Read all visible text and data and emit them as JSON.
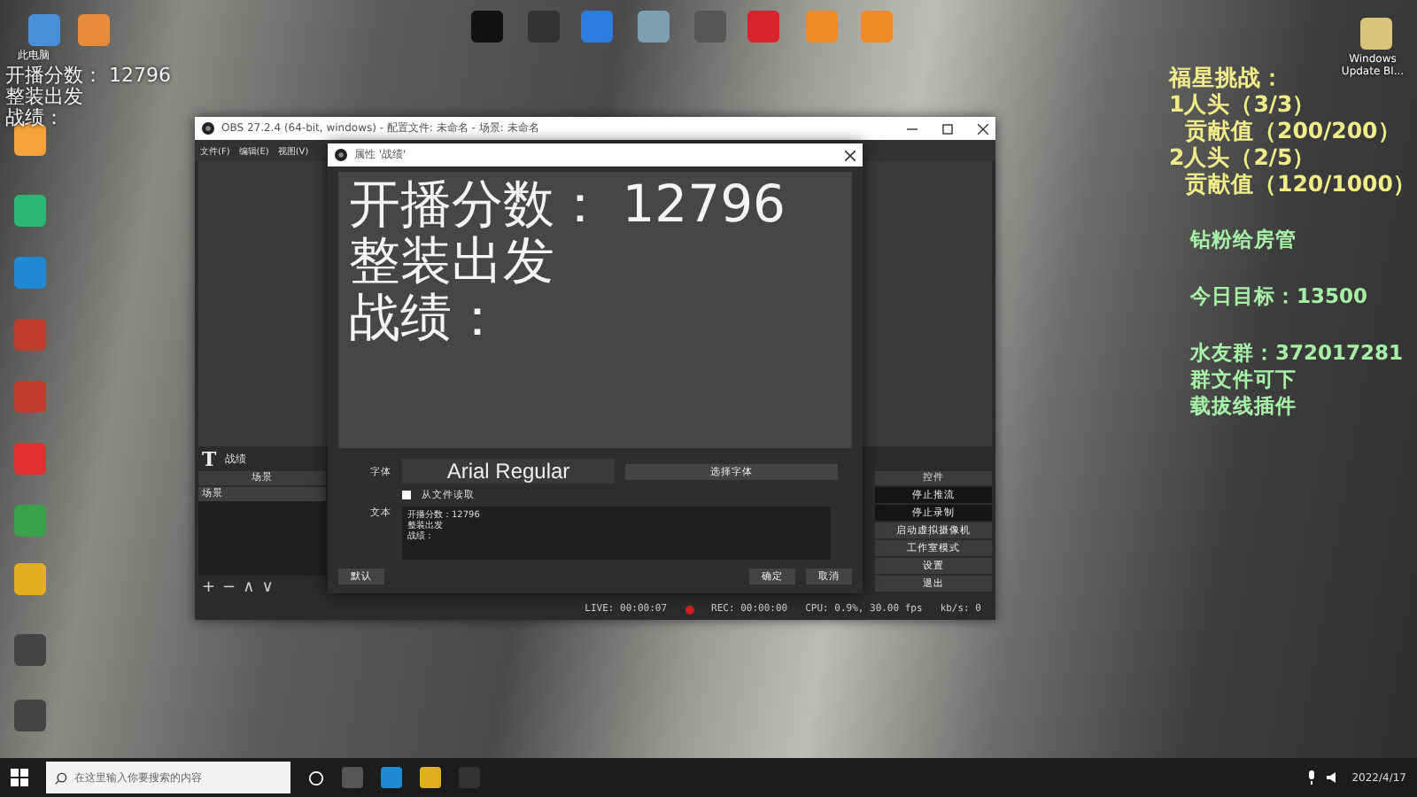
{
  "desktop_icons": [
    {
      "label": "此电脑"
    },
    {
      "label": "Windows Update Bl..."
    }
  ],
  "overlay_text": [
    "开播分数： 12796",
    "整装出发",
    "战绩："
  ],
  "challenge": {
    "title": "福星挑战：",
    "items": [
      {
        "text": "1人头（3/3）",
        "children": [
          {
            "text": "贡献值（200/200）"
          }
        ]
      },
      {
        "text": "2人头（2/5）",
        "children": [
          {
            "text": "贡献值（120/1000）"
          }
        ]
      }
    ]
  },
  "info_blocks": [
    [
      "钻粉给房管"
    ],
    [
      "今日目标：13500"
    ],
    [
      "水友群：372017281",
      "群文件可下",
      "载拔线插件"
    ]
  ],
  "obs_window": {
    "title": "OBS 27.2.4 (64-bit, windows) - 配置文件: 未命名 - 场景: 未命名",
    "menu": [
      "文件(F)",
      "编辑(E)",
      "视图(V)"
    ],
    "source": {
      "icon": "T",
      "name": "战绩"
    },
    "scenes": {
      "header": "场景",
      "items": [
        {
          "label": "场景",
          "selected": true
        }
      ],
      "buttons": [
        "+",
        "−",
        "∧",
        "∨"
      ]
    },
    "controls": {
      "header": "控件",
      "buttons": [
        {
          "label": "停止推流",
          "active": true
        },
        {
          "label": "停止录制",
          "active": true
        },
        {
          "label": "启动虚拟摄像机",
          "active": false
        },
        {
          "label": "工作室模式",
          "active": false
        },
        {
          "label": "设置",
          "active": false
        },
        {
          "label": "退出",
          "active": false
        }
      ]
    },
    "status": {
      "live": "LIVE: 00:00:07",
      "rec": "REC: 00:00:00",
      "cpu": "CPU: 0.9%, 30.00 fps",
      "kbps": "kb/s: 0"
    }
  },
  "dialog": {
    "title": "属性 '战绩'",
    "preview_lines": [
      "开播分数： 12796",
      "整装出发",
      "战绩："
    ],
    "font_label": "字体",
    "font_value": "Arial Regular",
    "font_button": "选择字体",
    "read_from_file": {
      "label": "从文件读取",
      "checked": false
    },
    "text_label": "文本",
    "text_lines": [
      "开播分数：12796",
      "整装出发",
      "战绩："
    ],
    "buttons": [
      "默认",
      "确定",
      "取消"
    ]
  },
  "taskbar": {
    "search_placeholder": "在这里输入你要搜索的内容",
    "date": "2022/4/17"
  }
}
